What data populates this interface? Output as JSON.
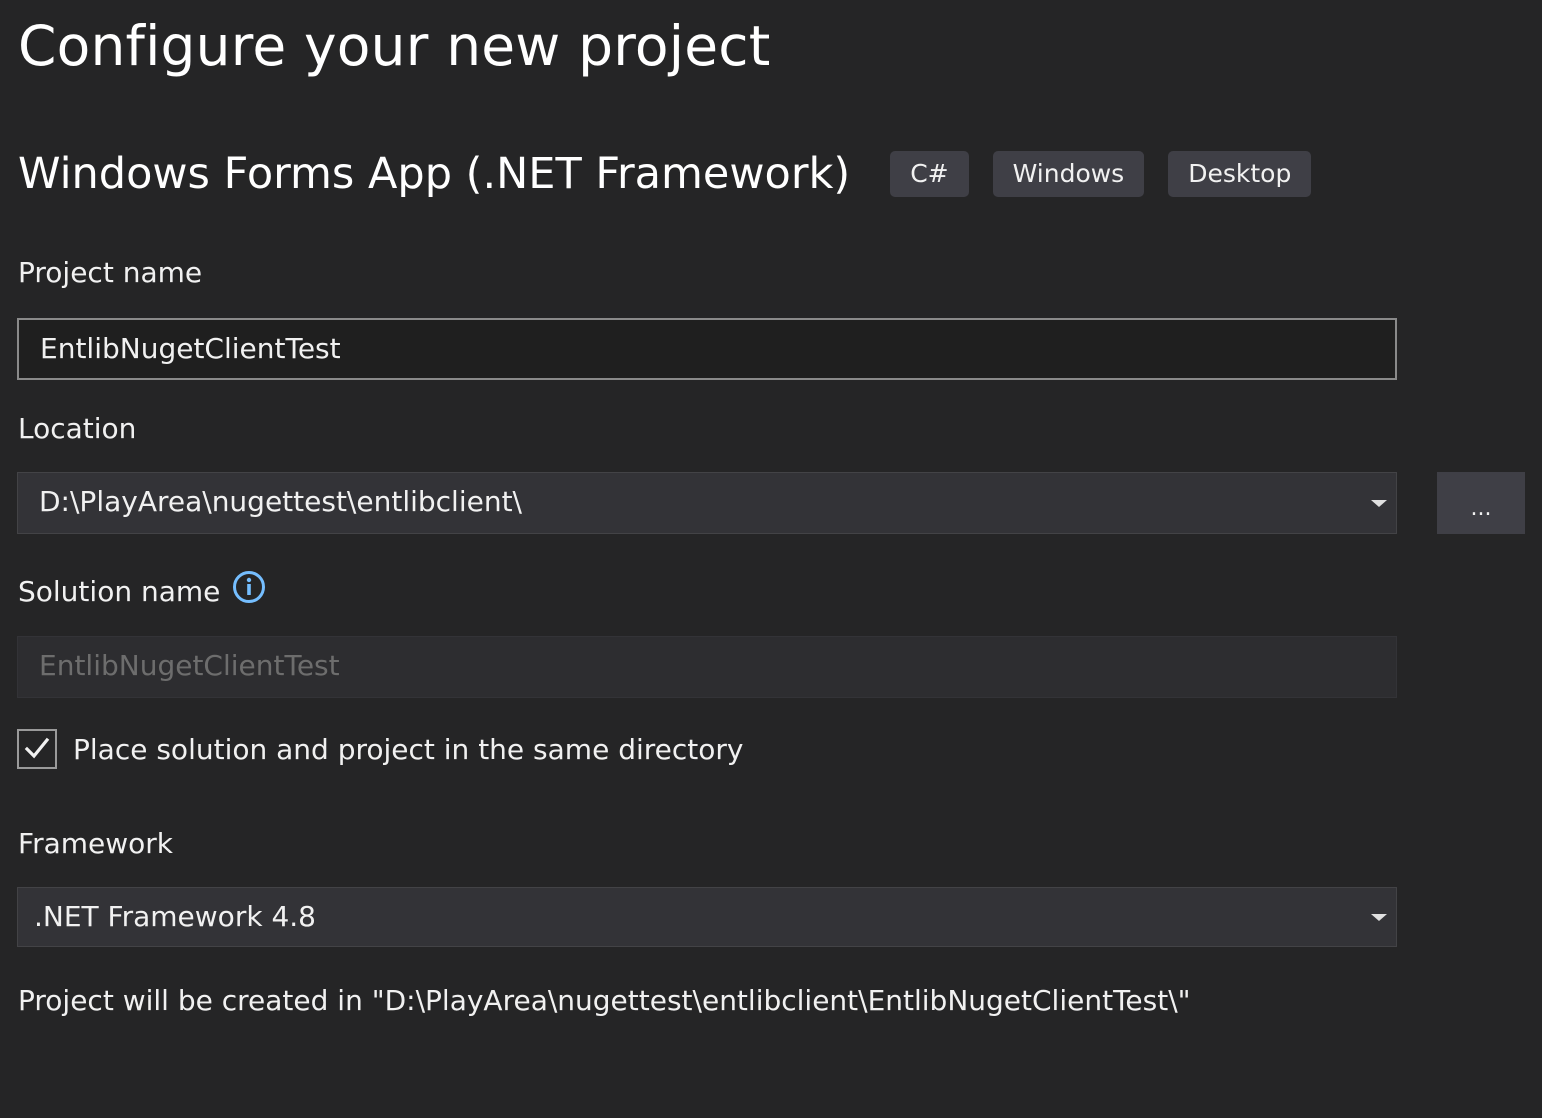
{
  "title": "Configure your new project",
  "template": {
    "name": "Windows Forms App (.NET Framework)",
    "tags": [
      "C#",
      "Windows",
      "Desktop"
    ]
  },
  "project_name": {
    "label": "Project name",
    "value": "EntlibNugetClientTest"
  },
  "location": {
    "label": "Location",
    "value": "D:\\PlayArea\\nugettest\\entlibclient\\",
    "browse_label": "..."
  },
  "solution_name": {
    "label": "Solution name",
    "value": "EntlibNugetClientTest",
    "info_icon": "info-icon",
    "disabled": true
  },
  "same_directory": {
    "label": "Place solution and project in the same directory",
    "checked": true
  },
  "framework": {
    "label": "Framework",
    "value": ".NET Framework 4.8"
  },
  "result_message": "Project will be created in \"D:\\PlayArea\\nugettest\\entlibclient\\EntlibNugetClientTest\\\"",
  "colors": {
    "background": "#252526",
    "info_icon": "#75beff",
    "tag_background": "#3f3f46"
  }
}
